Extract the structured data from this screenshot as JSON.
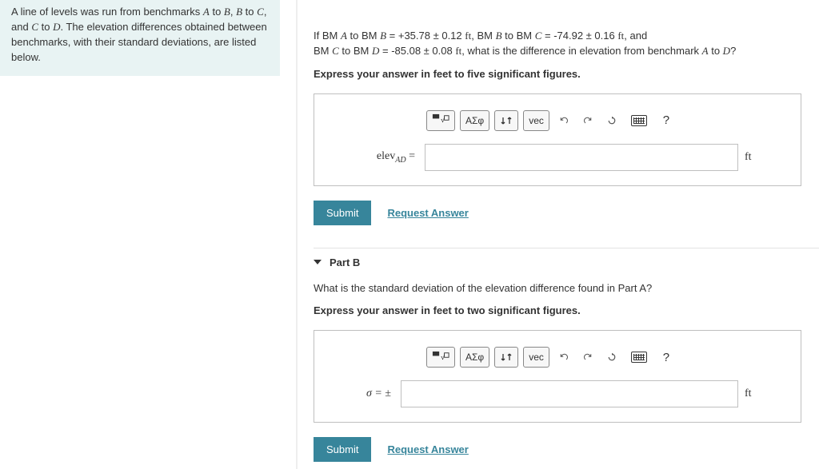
{
  "left_panel": {
    "text_parts": [
      "A line of levels was run from benchmarks ",
      "A",
      " to ",
      "B",
      ", ",
      "B",
      " to ",
      "C",
      ", and ",
      "C",
      " to ",
      "D",
      ". The elevation differences obtained between benchmarks, with their standard deviations, are listed below."
    ]
  },
  "partA": {
    "q_prefix": "If BM ",
    "seg1": [
      "A",
      " to BM ",
      "B",
      " = +35.78 ± 0.12 ",
      "ft",
      ", BM ",
      "B",
      " to BM ",
      "C",
      " = -74.92 ± 0.16 ",
      "ft",
      ", and"
    ],
    "seg2": [
      "BM ",
      "C",
      " to BM ",
      "D",
      " = -85.08 ± 0.08 ",
      "ft",
      ", what is the difference in elevation from benchmark ",
      "A",
      " to ",
      "D",
      "?"
    ],
    "instr": "Express your answer in feet to five significant figures.",
    "lhs_html": "elev",
    "lhs_sub": "AD",
    "lhs_eq": " =",
    "unit": "ft",
    "submit": "Submit",
    "request": "Request Answer"
  },
  "toolbar": {
    "greek": "ΑΣφ",
    "vec": "vec",
    "help": "?"
  },
  "partB": {
    "title": "Part B",
    "question": "What is the standard deviation of the elevation difference found in Part A?",
    "instr": "Express your answer in feet to two significant figures.",
    "lhs": "σ = ±",
    "unit": "ft",
    "submit": "Submit",
    "request": "Request Answer"
  }
}
